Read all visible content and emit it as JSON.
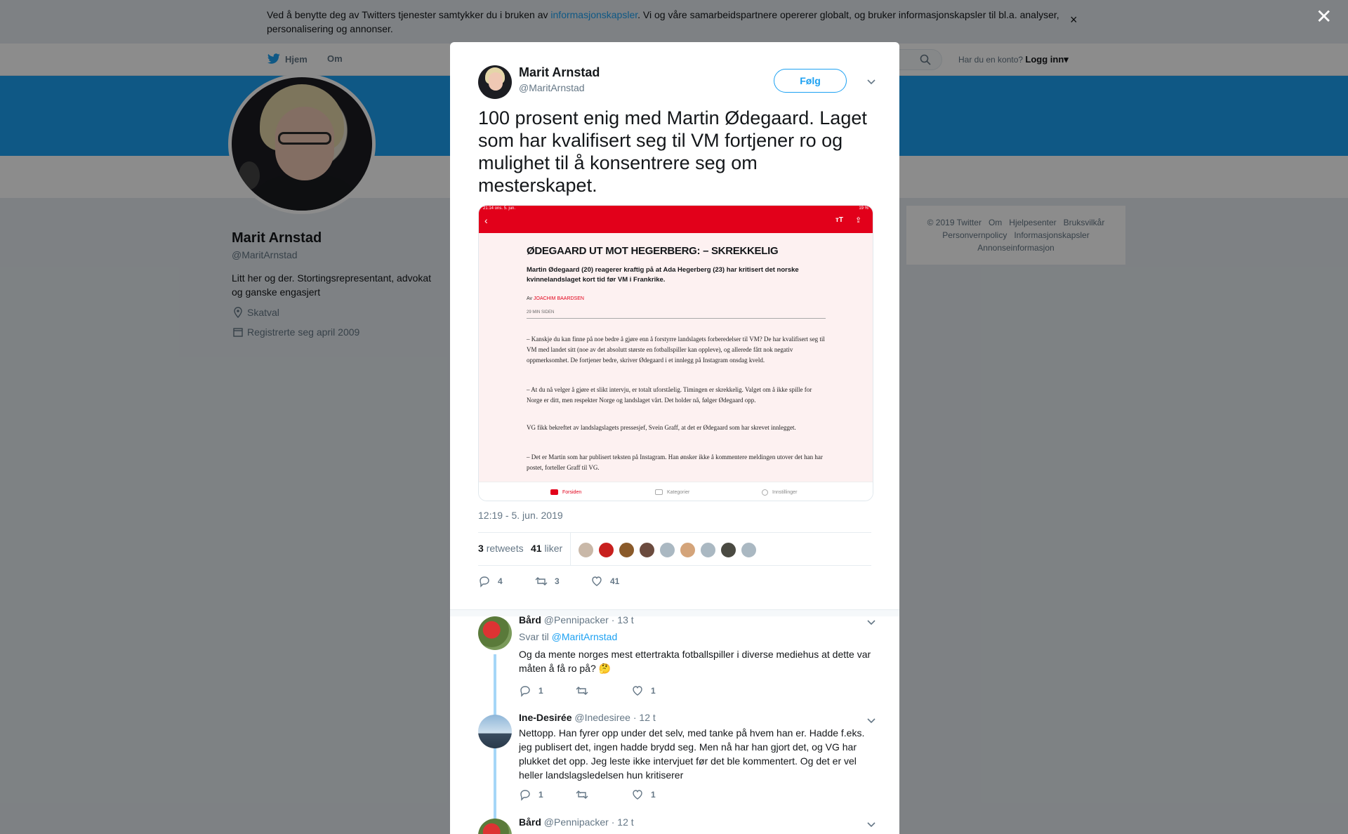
{
  "cookie_bar": {
    "text_before": "Ved å benytte deg av Twitters tjenester samtykker du i bruken av ",
    "link": "informasjonskapsler",
    "text_after": ". Vi og våre samarbeidspartnere opererer globalt, og bruker informasjonskapsler til bl.a. analyser, personalisering og annonser.",
    "close": "×"
  },
  "nav": {
    "home": "Hjem",
    "about": "Om",
    "account_prompt": "Har du en konto?",
    "login": "Logg inn"
  },
  "profile": {
    "name": "Marit Arnstad",
    "handle": "@MaritArnstad",
    "bio": "Litt her og der. Stortingsrepresentant, advokat og ganske engasjert",
    "location": "Skatval",
    "joined": "Registrerte seg april 2009"
  },
  "footer_links": [
    "© 2019 Twitter",
    "Om",
    "Hjelpesenter",
    "Bruksvilkår",
    "Personvernpolicy",
    "Informasjonskapsler",
    "Annonseinformasjon"
  ],
  "overlay_close": "✕",
  "tweet": {
    "author_name": "Marit Arnstad",
    "author_handle": "@MaritArnstad",
    "follow_label": "Følg",
    "text": "100 prosent enig med Martin Ødegaard. Laget som har kvalifisert seg til VM fortjener ro og mulighet til å konsentrere seg om mesterskapet.",
    "timestamp": "12:19 - 5. jun. 2019",
    "retweets_count": "3",
    "retweets_label": "retweets",
    "likes_count": "41",
    "likes_label": "liker",
    "reply_count": "4",
    "retweet_action_count": "3",
    "like_action_count": "41",
    "colors": {
      "accent": "#1da1f2",
      "like": "#657786"
    }
  },
  "media": {
    "status_left": "21:14  ons. 5. jun.",
    "status_right": "19 %",
    "tt": "тT",
    "headline": "ØDEGAARD UT MOT HEGERBERG: – SKREKKELIG",
    "lead": "Martin Ødegaard (20) reagerer kraftig på at Ada Hegerberg (23) har kritisert det norske kvinnelandslaget kort tid før VM i Frankrike.",
    "by_prefix": "Av ",
    "byline": "JOACHIM BAARDSEN",
    "time": "29 MIN SIDEN",
    "paragraphs": [
      "– Kanskje du kan finne på noe bedre å gjøre enn å forstyrre landslagets forberedelser til VM? De har kvalifisert seg til VM med landet sitt (noe av det absolutt største en fotballspiller kan oppleve), og allerede fått nok negativ oppmerksomhet. De fortjener bedre, skriver Ødegaard i et innlegg på Instagram onsdag kveld.",
      "– At du nå velger å gjøre et slikt intervju, er totalt uforståelig. Timingen er skrekkelig. Valget om å ikke spille for Norge er ditt, men respekter Norge og landslaget vårt. Det holder nå, følger Ødegaard opp.",
      "VG fikk bekreftet av landslagslagets pressesjef, Svein Graff, at det er Ødegaard som har skrevet innlegget.",
      "– Det er Martin som har publisert teksten på Instagram. Han ønsker ikke å kommentere meldingen utover det han har postet, forteller Graff til VG."
    ],
    "tabs": [
      "Forsiden",
      "Kategorier",
      "Innstillinger"
    ]
  },
  "replies": [
    {
      "name": "Bård",
      "handle": "@Pennipacker",
      "time": "· 13 t",
      "reply_to_label": "Svar til ",
      "reply_to": "@MaritArnstad",
      "text": "Og da mente norges mest ettertrakta fotballspiller i diverse mediehus at dette var måten å få ro på? 🤔",
      "replies": "1",
      "likes": "1"
    },
    {
      "name": "Ine-Desirée",
      "handle": "@Inedesiree",
      "time": "· 12 t",
      "text": "Nettopp. Han fyrer opp under det selv, med tanke på hvem han er. Hadde f.eks. jeg publisert det, ingen hadde brydd seg. Men nå har han gjort det, og VG har plukket det opp. Jeg leste ikke intervjuet før det ble kommentert. Og det er vel heller landslagsledelsen hun kritiserer",
      "replies": "1",
      "likes": "1"
    },
    {
      "name": "Bård",
      "handle": "@Pennipacker",
      "time": "· 12 t"
    }
  ]
}
